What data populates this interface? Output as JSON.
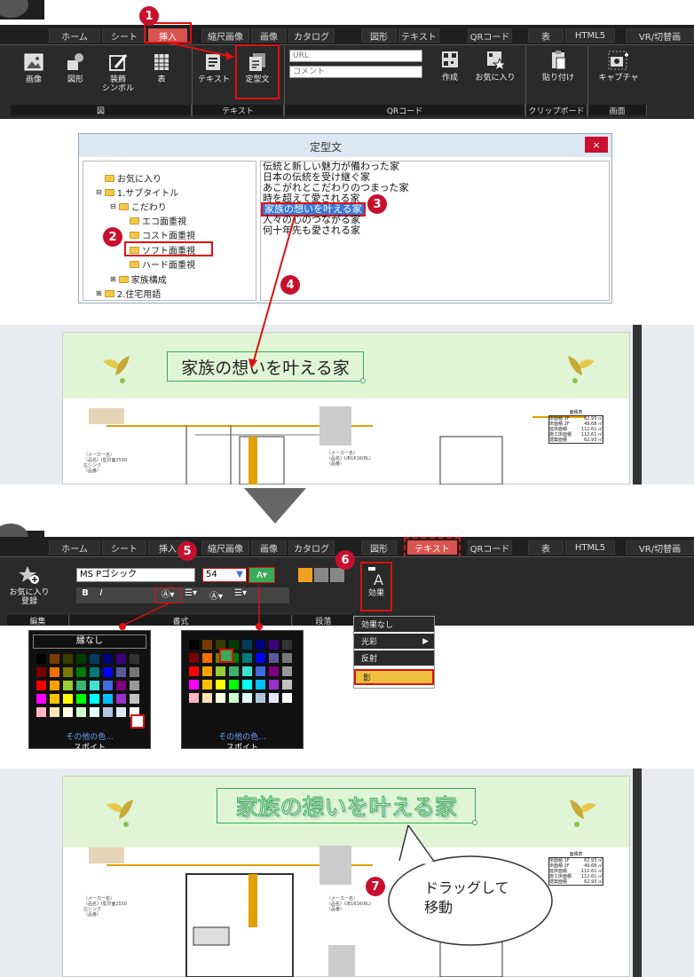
{
  "top_ribbon": {
    "tabs": [
      "ホーム",
      "シート",
      "挿入",
      "縮尺画像",
      "画像",
      "カタログ",
      "図形",
      "テキスト",
      "QRコード",
      "表",
      "HTML5",
      "VR/切替画"
    ],
    "buttons": {
      "image": "画像",
      "shape": "図形",
      "symbol": "装飾\nシンボル",
      "table": "表",
      "text": "テキスト",
      "fixed_text": "定型文",
      "qr_create": "作成",
      "qr_favorite": "お気に入り",
      "paste": "貼り付け",
      "capture": "キャプチャ"
    },
    "url_placeholder": "URL",
    "comment_placeholder": "コメント",
    "groups": [
      "図",
      "テキスト",
      "QRコード",
      "クリップボード",
      "画面"
    ]
  },
  "dialog": {
    "title": "定型文",
    "tree": [
      "お気に入り",
      "1.サブタイトル",
      "こだわり",
      "エコ面重視",
      "コスト面重視",
      "ソフト面重視",
      "ハード面重視",
      "家族構成",
      "2.住宅用語"
    ],
    "phrases": [
      "伝統と新しい魅力が備わった家",
      "日本の伝統を受け継ぐ家",
      "あこがれとこだわりのつまった家",
      "時を超えて愛される家",
      "家族の想いを叶える家",
      "人々の心のつながる家",
      "何十年先も愛される家"
    ]
  },
  "doc": {
    "title_text": "家族の想いを叶える家"
  },
  "area_table": {
    "title": "面積表",
    "rows": [
      [
        "床面積 1F",
        "62.93 ㎡"
      ],
      [
        "床面積 2F",
        "49.68 ㎡"
      ],
      [
        "延床面積",
        "112.61 ㎡"
      ],
      [
        "施工床面積",
        "112.61 ㎡"
      ],
      [
        "建築面積",
        "62.93 ㎡"
      ]
    ]
  },
  "furniture_notes": {
    "kitchen": "〈メーカー名〉\n〈品名〉I型対面2550\n左シンク\n〈品番〉",
    "bath": "〈メーカー名〉\n〈品名〉UB1616(BL)\n〈品番〉"
  },
  "bottom_ribbon": {
    "tabs": [
      "ホーム",
      "シート",
      "挿入",
      "縮尺画像",
      "画像",
      "カタログ",
      "図形",
      "テキスト",
      "QRコード",
      "表",
      "HTML5",
      "VR/切替画"
    ],
    "favorite_register": "お気に入り\n登録",
    "font_name": "MS Pゴシック",
    "font_size": "54",
    "effect": "効果",
    "groups": [
      "編集",
      "書式",
      "段落"
    ]
  },
  "palette1": {
    "no_border": "縁なし",
    "more_colors": "その他の色...",
    "eyedropper": "スポイト"
  },
  "palette2": {
    "more_colors": "その他の色...",
    "eyedropper": "スポイト"
  },
  "effects_menu": [
    "効果なし",
    "光彩",
    "反射",
    "影"
  ],
  "instruction": "ドラッグして\n移動",
  "callouts": [
    "1",
    "2",
    "3",
    "4",
    "5",
    "6",
    "7"
  ]
}
